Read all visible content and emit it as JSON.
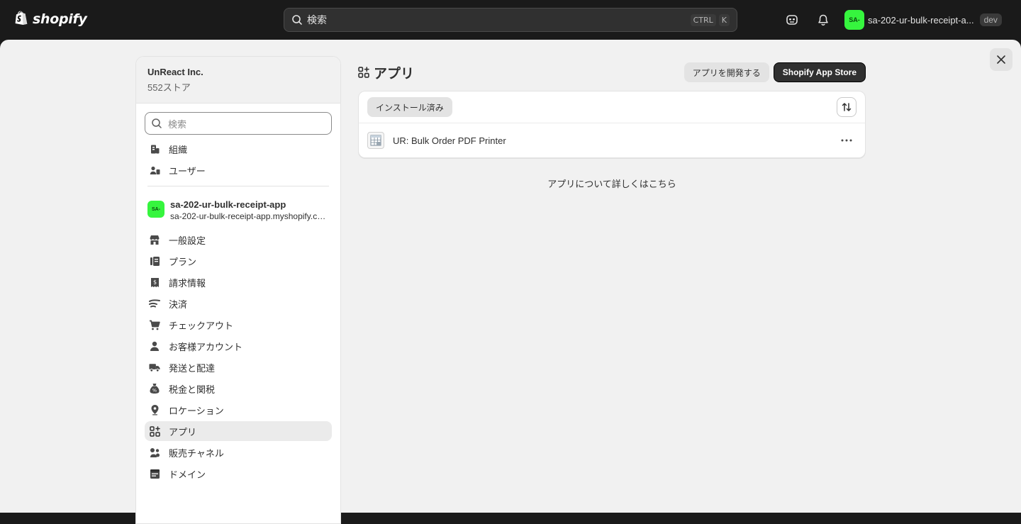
{
  "topbar": {
    "logo_text": "shopify",
    "search_placeholder": "検索",
    "shortcut_key1": "CTRL",
    "shortcut_key2": "K",
    "store_avatar": "SA-",
    "store_name": "sa-202-ur-bulk-receipt-a...",
    "env_badge": "dev",
    "icons": [
      "shopify-bag-icon",
      "search-icon",
      "agent-icon",
      "bell-icon"
    ]
  },
  "sidebar": {
    "org_name": "UnReact Inc.",
    "org_stores": "552ストア",
    "search_placeholder": "検索",
    "top_items": [
      {
        "label": "組織",
        "icon": "organization-icon"
      },
      {
        "label": "ユーザー",
        "icon": "users-icon"
      }
    ],
    "store": {
      "avatar": "SA-",
      "name": "sa-202-ur-bulk-receipt-app",
      "domain": "sa-202-ur-bulk-receipt-app.myshopify.com"
    },
    "items": [
      {
        "label": "一般設定",
        "icon": "store-icon"
      },
      {
        "label": "プラン",
        "icon": "plan-icon"
      },
      {
        "label": "請求情報",
        "icon": "receipt-icon"
      },
      {
        "label": "決済",
        "icon": "payment-icon"
      },
      {
        "label": "チェックアウト",
        "icon": "cart-icon"
      },
      {
        "label": "お客様アカウント",
        "icon": "person-icon"
      },
      {
        "label": "発送と配達",
        "icon": "truck-icon"
      },
      {
        "label": "税金と関税",
        "icon": "tax-icon"
      },
      {
        "label": "ロケーション",
        "icon": "location-icon"
      },
      {
        "label": "アプリ",
        "icon": "apps-icon",
        "active": true
      },
      {
        "label": "販売チャネル",
        "icon": "channels-icon"
      },
      {
        "label": "ドメイン",
        "icon": "domain-icon"
      }
    ]
  },
  "main": {
    "title": "アプリ",
    "develop_button": "アプリを開発する",
    "app_store_button": "Shopify App Store",
    "filter_tab": "インストール済み",
    "apps": [
      {
        "name": "UR: Bulk Order PDF Printer"
      }
    ],
    "learn_more": "アプリについて詳しくはこちら"
  },
  "colors": {
    "topbar_bg": "#1a1a1a",
    "page_bg": "#f1f1f1",
    "store_avatar": "#36f53e",
    "primary_button": "#303030"
  }
}
